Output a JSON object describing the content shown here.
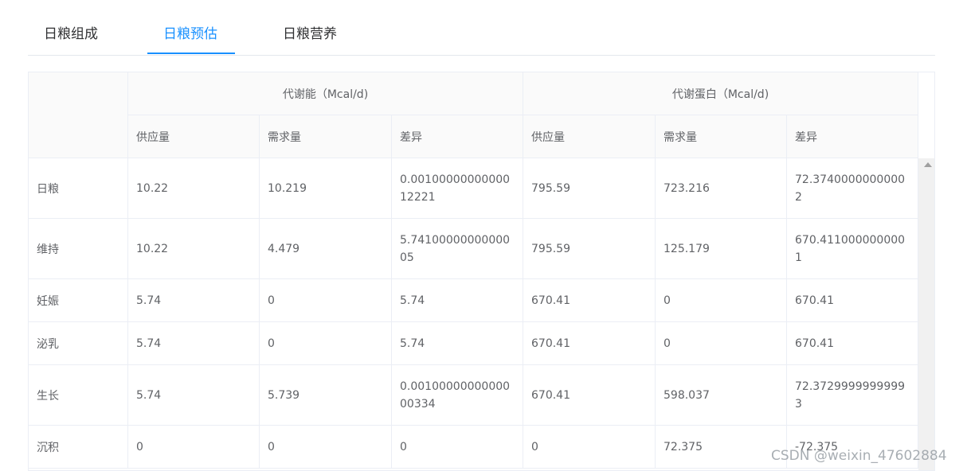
{
  "tabs": [
    {
      "label": "日粮组成"
    },
    {
      "label": "日粮预估"
    },
    {
      "label": "日粮营养"
    }
  ],
  "table": {
    "groups": [
      "代谢能（Mcal/d)",
      "代谢蛋白（Mcal/d)"
    ],
    "subheaders": [
      "供应量",
      "需求量",
      "差异",
      "供应量",
      "需求量",
      "差异"
    ],
    "rows": [
      {
        "label": "日粮",
        "cells": [
          "10.22",
          "10.219",
          "0.0010000000000012221",
          "795.59",
          "723.216",
          "72.37400000000002"
        ]
      },
      {
        "label": "维持",
        "cells": [
          "10.22",
          "4.479",
          "5.7410000000000005",
          "795.59",
          "125.179",
          "670.4110000000001"
        ]
      },
      {
        "label": "妊娠",
        "cells": [
          "5.74",
          "0",
          "5.74",
          "670.41",
          "0",
          "670.41"
        ]
      },
      {
        "label": "泌乳",
        "cells": [
          "5.74",
          "0",
          "5.74",
          "670.41",
          "0",
          "670.41"
        ]
      },
      {
        "label": "生长",
        "cells": [
          "5.74",
          "5.739",
          "0.0010000000000000334",
          "670.41",
          "598.037",
          "72.37299999999993"
        ]
      },
      {
        "label": "沉积",
        "cells": [
          "0",
          "0",
          "0",
          "0",
          "72.375",
          "-72.375"
        ]
      }
    ]
  },
  "watermark": "CSDN @weixin_47602884"
}
